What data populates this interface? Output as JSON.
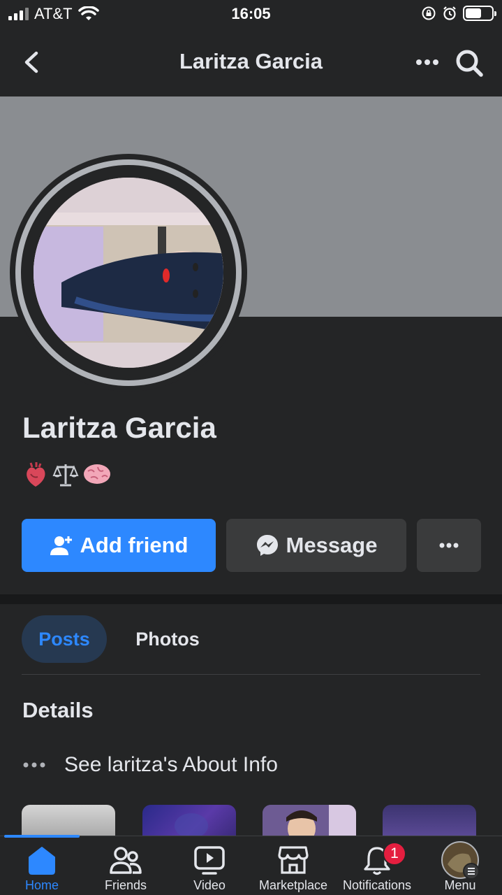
{
  "status_bar": {
    "carrier": "AT&T",
    "time": "16:05"
  },
  "nav": {
    "title": "Laritza Garcia",
    "icons": [
      "back-chevron-icon",
      "more-dots-icon",
      "search-icon"
    ]
  },
  "profile": {
    "name": "Laritza Garcia",
    "bio_emojis": [
      "anatomical-heart",
      "balance-scale",
      "brain"
    ]
  },
  "actions": {
    "add_friend": "Add friend",
    "message": "Message"
  },
  "tabs": {
    "posts": "Posts",
    "photos": "Photos"
  },
  "details": {
    "title": "Details",
    "about": "See laritza's About Info"
  },
  "tabbar": {
    "items": [
      {
        "label": "Home",
        "icon": "home-icon",
        "active": true
      },
      {
        "label": "Friends",
        "icon": "friends-icon"
      },
      {
        "label": "Video",
        "icon": "video-icon"
      },
      {
        "label": "Marketplace",
        "icon": "marketplace-icon"
      },
      {
        "label": "Notifications",
        "icon": "bell-icon",
        "badge": "1"
      },
      {
        "label": "Menu",
        "icon": "menu-avatar-icon"
      }
    ]
  },
  "colors": {
    "background": "#242526",
    "accent": "#2d88ff",
    "button_secondary": "#3a3b3c",
    "badge": "#e41e3f"
  }
}
